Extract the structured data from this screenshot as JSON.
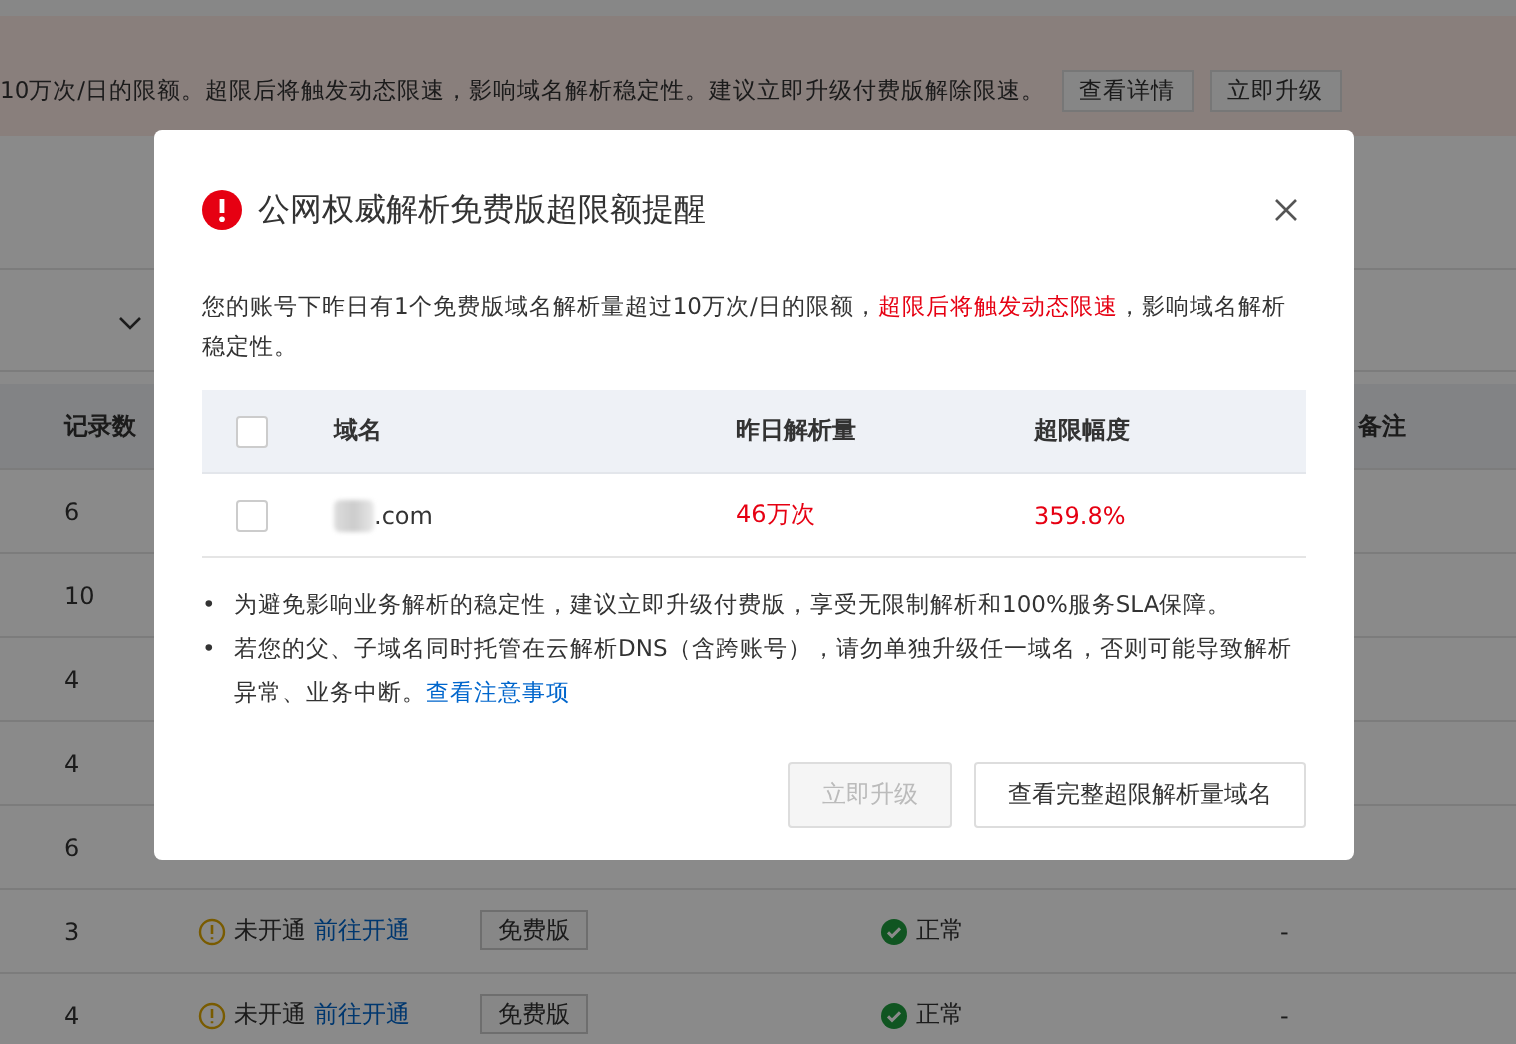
{
  "page": {
    "banner": {
      "text": "10万次/日的限额。超限后将触发动态限速，影响域名解析稳定性。建议立即升级付费版解除限速。",
      "buttons": [
        "查看详情",
        "立即升级"
      ]
    },
    "columns": [
      "记录数",
      "备注"
    ],
    "rows": [
      {
        "records": "6"
      },
      {
        "records": "10"
      },
      {
        "records": "4"
      },
      {
        "records": "4"
      },
      {
        "records": "6"
      },
      {
        "records": "3",
        "status": "未开通",
        "action": "前往开通",
        "edition": "免费版",
        "health": "正常",
        "note": "-"
      },
      {
        "records": "4",
        "status": "未开通",
        "action": "前往开通",
        "edition": "免费版",
        "health": "正常",
        "note": "-"
      }
    ]
  },
  "dialog": {
    "title": "公网权威解析免费版超限额提醒",
    "message": [
      {
        "text": "您的账号下昨日有1个免费版域名解析量超过10万次/日的限额，",
        "alert": false
      },
      {
        "text": "超限后将触发动态限速",
        "alert": true
      },
      {
        "text": "，影响域名解析稳定性。",
        "alert": false
      }
    ],
    "table": {
      "columns": [
        "域名",
        "昨日解析量",
        "超限幅度"
      ],
      "select_all": false,
      "rows": [
        {
          "checked": false,
          "domain": ".com",
          "domain_blurred": true,
          "queries": "46万次",
          "excess": "359.8%"
        }
      ]
    },
    "notes": [
      {
        "marker": "•",
        "text": "为避免影响业务解析的稳定性，建议立即升级付费版，享受无限制解析和100%服务SLA保障。"
      },
      {
        "marker": "•",
        "text": "若您的父、子域名同时托管在云解析DNS（含跨账号），请勿单独升级任一域名，否则可能导致解析异常、业务中断。",
        "link": "查看注意事项"
      }
    ],
    "buttons": [
      {
        "label": "立即升级",
        "disabled": true
      },
      {
        "label": "查看完整超限解析量域名",
        "disabled": false
      }
    ]
  }
}
